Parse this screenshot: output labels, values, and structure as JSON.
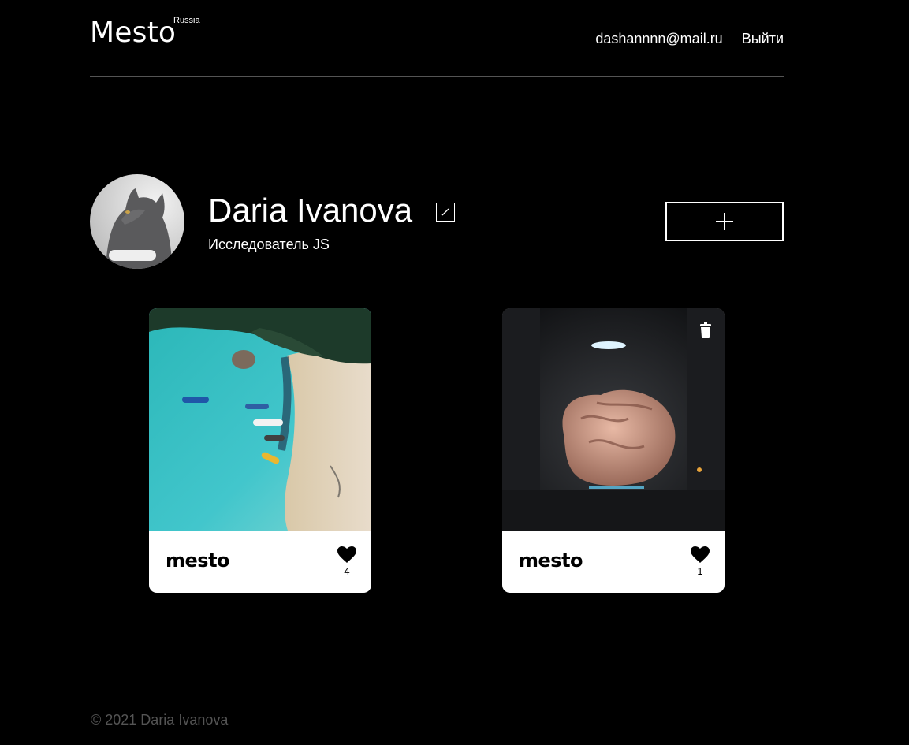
{
  "header": {
    "logo": "Mesto",
    "logo_sup": "Russia",
    "email": "dashannnn@mail.ru",
    "logout": "Выйти"
  },
  "profile": {
    "name": "Daria Ivanova",
    "about": "Исследователь JS"
  },
  "cards": [
    {
      "title": "mesto",
      "likes": "4",
      "image": "beach-aerial-boats",
      "deletable": false
    },
    {
      "title": "mesto",
      "likes": "1",
      "image": "brain-in-lab",
      "deletable": true
    }
  ],
  "footer": {
    "copyright": "© 2021 Daria Ivanova"
  },
  "colors": {
    "background": "#000000",
    "card": "#ffffff",
    "divider": "#545454",
    "footer_text": "#545454"
  }
}
